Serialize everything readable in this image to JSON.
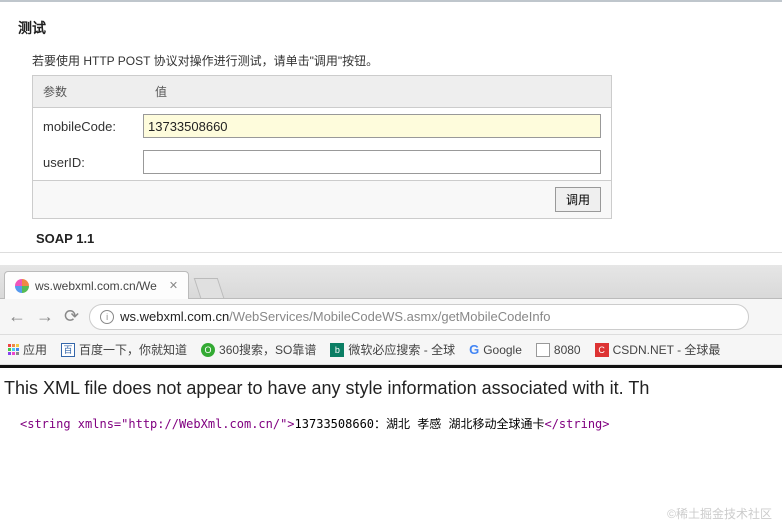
{
  "top": {
    "title": "测试",
    "instruction": "若要使用 HTTP POST 协议对操作进行测试，请单击\"调用\"按钮。",
    "headers": {
      "param": "参数",
      "value": "值"
    },
    "params": [
      {
        "label": "mobileCode:",
        "value": "13733508660",
        "highlighted": true
      },
      {
        "label": "userID:",
        "value": "",
        "highlighted": false
      }
    ],
    "invoke": "调用",
    "soap": "SOAP 1.1"
  },
  "browser": {
    "tab_title": "ws.webxml.com.cn/We",
    "url_host": "ws.webxml.com.cn",
    "url_path": "/WebServices/MobileCodeWS.asmx/getMobileCodeInfo",
    "bookmarks": {
      "apps": "应用",
      "baidu": "百度一下，你就知道",
      "s360": "360搜索，SO靠谱",
      "bing": "微软必应搜索 - 全球",
      "google": "Google",
      "p8080": "8080",
      "csdn": "CSDN.NET - 全球最"
    }
  },
  "xml": {
    "message": "This XML file does not appear to have any style information associated with it. Th",
    "open_tag": "<string xmlns=\"http://WebXml.com.cn/\">",
    "text": "13733508660：湖北 孝感 湖北移动全球通卡",
    "close_tag": "</string>"
  },
  "watermark": "©稀土掘金技术社区"
}
